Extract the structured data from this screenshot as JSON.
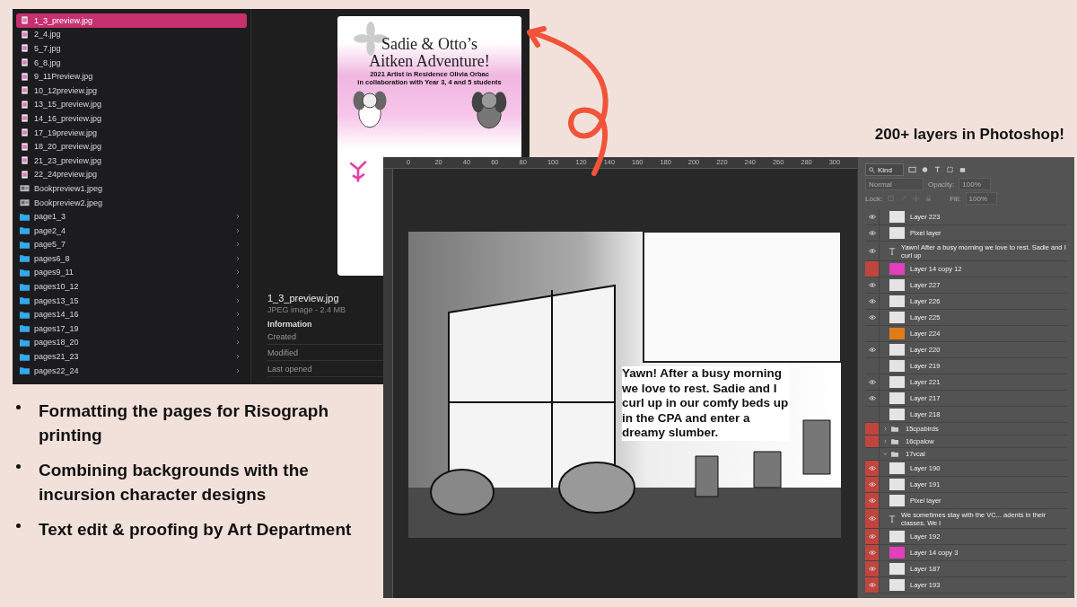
{
  "finder": {
    "files": [
      {
        "name": "1_3_preview.jpg",
        "kind": "file",
        "selected": true
      },
      {
        "name": "2_4.jpg",
        "kind": "file",
        "selected": false
      },
      {
        "name": "5_7.jpg",
        "kind": "file",
        "selected": false
      },
      {
        "name": "6_8.jpg",
        "kind": "file",
        "selected": false
      },
      {
        "name": "9_11Preview.jpg",
        "kind": "file",
        "selected": false
      },
      {
        "name": "10_12preview.jpg",
        "kind": "file",
        "selected": false
      },
      {
        "name": "13_15_preview.jpg",
        "kind": "file",
        "selected": false
      },
      {
        "name": "14_16_preview.jpg",
        "kind": "file",
        "selected": false
      },
      {
        "name": "17_19preview.jpg",
        "kind": "file",
        "selected": false
      },
      {
        "name": "18_20_preview.jpg",
        "kind": "file",
        "selected": false
      },
      {
        "name": "21_23_preview.jpg",
        "kind": "file",
        "selected": false
      },
      {
        "name": "22_24preview.jpg",
        "kind": "file",
        "selected": false
      },
      {
        "name": "Bookpreview1.jpeg",
        "kind": "photo",
        "selected": false
      },
      {
        "name": "Bookpreview2.jpeg",
        "kind": "photo",
        "selected": false
      },
      {
        "name": "page1_3",
        "kind": "folder",
        "selected": false
      },
      {
        "name": "page2_4",
        "kind": "folder",
        "selected": false
      },
      {
        "name": "page5_7",
        "kind": "folder",
        "selected": false
      },
      {
        "name": "pages6_8",
        "kind": "folder",
        "selected": false
      },
      {
        "name": "pages9_11",
        "kind": "folder",
        "selected": false
      },
      {
        "name": "pages10_12",
        "kind": "folder",
        "selected": false
      },
      {
        "name": "pages13_15",
        "kind": "folder",
        "selected": false
      },
      {
        "name": "pages14_16",
        "kind": "folder",
        "selected": false
      },
      {
        "name": "pages17_19",
        "kind": "folder",
        "selected": false
      },
      {
        "name": "pages18_20",
        "kind": "folder",
        "selected": false
      },
      {
        "name": "pages21_23",
        "kind": "folder",
        "selected": false
      },
      {
        "name": "pages22_24",
        "kind": "folder",
        "selected": false
      }
    ],
    "preview": {
      "cover_title": [
        "Sadie & Otto’s",
        "Aitken Adventure!"
      ],
      "cover_lines": [
        "2021 Artist in Residence Olivia Orbac",
        "in collaboration with Year 3, 4 and 5 students"
      ]
    },
    "info": {
      "file_name": "1_3_preview.jpg",
      "file_type": "JPEG image - 2.4 MB",
      "heading": "Information",
      "rows": [
        "Created",
        "Modified",
        "Last opened"
      ]
    }
  },
  "headline": "200+ layers in Photoshop!",
  "photoshop": {
    "ruler_ticks": [
      "0",
      "20",
      "40",
      "60",
      "80",
      "100",
      "120",
      "140",
      "160",
      "180",
      "200",
      "220",
      "240",
      "260",
      "280",
      "300"
    ],
    "artwork_text": "Yawn! After a busy morning we love to rest. Sadie and I curl up in our comfy beds up in the CPA and enter a dreamy slumber.",
    "layers_panel": {
      "filter": "Kind",
      "blend_mode": "Normal",
      "opacity_label": "Opacity:",
      "opacity": "100%",
      "lock_label": "Lock:",
      "fill_label": "Fill:",
      "fill": "100%",
      "layers": [
        {
          "name": "Layer 223",
          "kind": "layer",
          "color": "#e4e4e4",
          "visible": true,
          "highlighted": false
        },
        {
          "name": "Pixel layer",
          "kind": "layer",
          "color": "#e4e4e4",
          "visible": true,
          "highlighted": false
        },
        {
          "name": "Yawn! After a busy morning we love to rest. Sadie and I curl up",
          "kind": "text",
          "visible": true,
          "highlighted": false
        },
        {
          "name": "Layer 14 copy 12",
          "kind": "layer",
          "color": "#e23fbd",
          "visible": false,
          "highlighted": true
        },
        {
          "name": "Layer 227",
          "kind": "layer",
          "color": "#e4e4e4",
          "visible": true,
          "highlighted": false
        },
        {
          "name": "Layer 226",
          "kind": "layer",
          "color": "#e4e4e4",
          "visible": true,
          "highlighted": false
        },
        {
          "name": "Layer 225",
          "kind": "layer",
          "color": "#e4e4e4",
          "visible": true,
          "highlighted": false
        },
        {
          "name": "Layer 224",
          "kind": "layer",
          "color": "#e07b1a",
          "visible": false,
          "highlighted": false
        },
        {
          "name": "Layer 220",
          "kind": "layer",
          "color": "#e4e4e4",
          "visible": true,
          "highlighted": false
        },
        {
          "name": "Layer 219",
          "kind": "layer",
          "color": "#e4e4e4",
          "visible": false,
          "highlighted": false
        },
        {
          "name": "Layer 221",
          "kind": "layer",
          "color": "#e4e4e4",
          "visible": true,
          "highlighted": false
        },
        {
          "name": "Layer 217",
          "kind": "layer",
          "color": "#e4e4e4",
          "visible": true,
          "highlighted": false
        },
        {
          "name": "Layer 218",
          "kind": "layer",
          "color": "#e4e4e4",
          "visible": false,
          "highlighted": false
        },
        {
          "name": "15cpabirds",
          "kind": "group",
          "visible": false,
          "highlighted": true,
          "expanded": false
        },
        {
          "name": "16cpalow",
          "kind": "group",
          "visible": false,
          "highlighted": true,
          "expanded": false
        },
        {
          "name": "17vcal",
          "kind": "group",
          "visible": false,
          "highlighted": false,
          "expanded": true,
          "children": [
            {
              "name": "Layer 190",
              "kind": "layer",
              "color": "#e4e4e4",
              "visible": true,
              "highlighted": true
            },
            {
              "name": "Layer 191",
              "kind": "layer",
              "color": "#e4e4e4",
              "visible": true,
              "highlighted": true
            },
            {
              "name": "Pixel layer",
              "kind": "layer",
              "color": "#e4e4e4",
              "visible": true,
              "highlighted": true
            },
            {
              "name": "We sometimes stay with the VC... adents in their classes. We l",
              "kind": "text",
              "visible": true,
              "highlighted": true
            },
            {
              "name": "Layer 192",
              "kind": "layer",
              "color": "#e4e4e4",
              "visible": true,
              "highlighted": true
            },
            {
              "name": "Layer 14 copy 3",
              "kind": "layer",
              "color": "#e23fbd",
              "visible": true,
              "highlighted": true
            },
            {
              "name": "Layer 187",
              "kind": "layer",
              "color": "#e4e4e4",
              "visible": true,
              "highlighted": true
            },
            {
              "name": "Layer 193",
              "kind": "layer",
              "color": "#e4e4e4",
              "visible": true,
              "highlighted": true
            }
          ]
        }
      ]
    }
  },
  "bullets": [
    "Formatting the pages for Risograph printing",
    "Combining backgrounds with the incursion character designs",
    "Text edit & proofing by Art Department"
  ]
}
